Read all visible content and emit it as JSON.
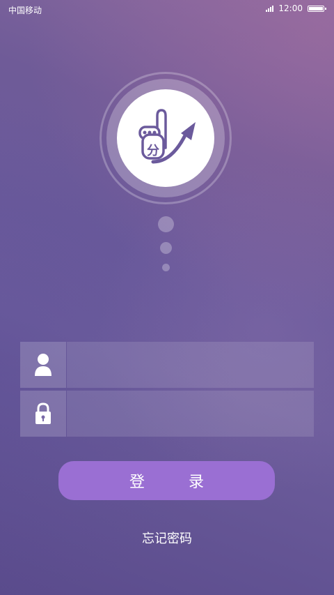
{
  "status_bar": {
    "carrier": "中国移动",
    "time": "12:00",
    "signal_icon": "signal-bars-icon",
    "battery_icon": "battery-full-icon"
  },
  "logo": {
    "glyph": "分",
    "icon": "hand-pointing-up-arrow-logo"
  },
  "login_form": {
    "username": {
      "icon": "user-icon",
      "value": "",
      "placeholder": ""
    },
    "password": {
      "icon": "lock-icon",
      "value": "",
      "placeholder": ""
    },
    "login_label": "登 录",
    "forgot_label": "忘记密码"
  },
  "colors": {
    "background_top": "#8a6a9f",
    "background_bottom": "#5a4b8c",
    "button": "#9a6fd3",
    "logo_stroke": "#6b5a9c"
  }
}
